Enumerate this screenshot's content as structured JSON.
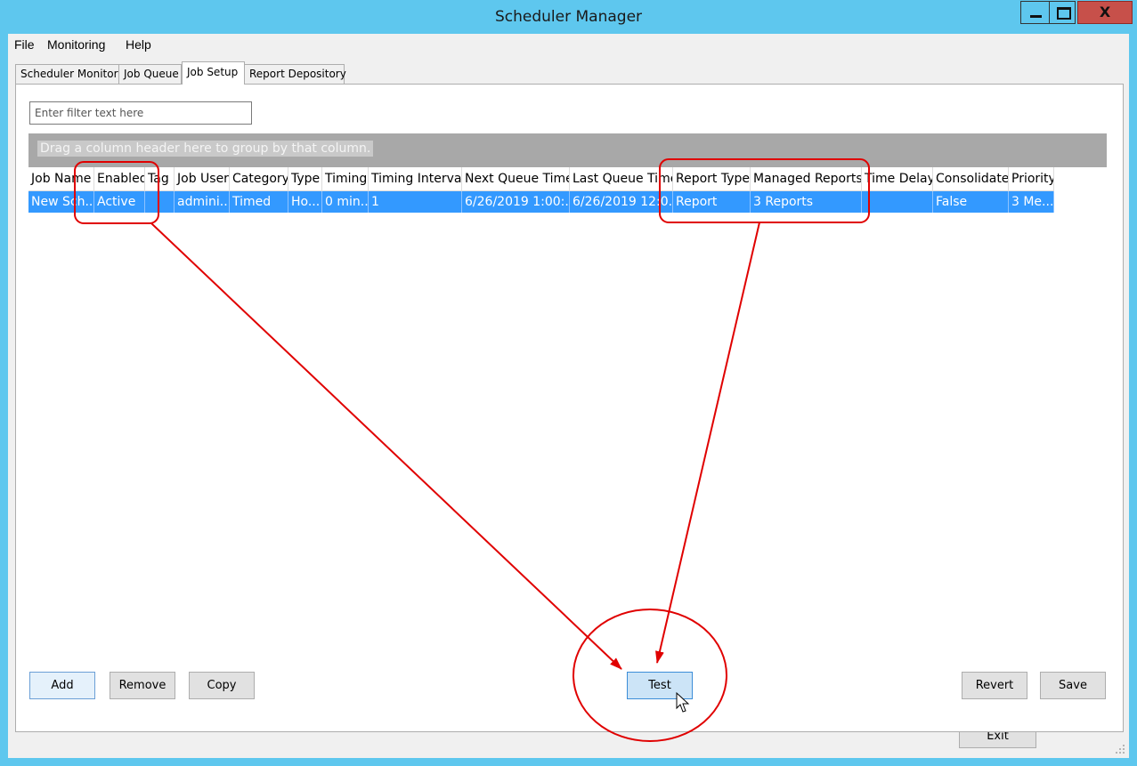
{
  "window": {
    "title": "Scheduler Manager",
    "close_glyph": "X"
  },
  "menu": [
    "File",
    "Monitoring",
    "Help"
  ],
  "tabs": [
    {
      "label": "Scheduler Monitor",
      "active": false
    },
    {
      "label": "Job Queue",
      "active": false
    },
    {
      "label": "Job Setup",
      "active": true
    },
    {
      "label": "Report Depository",
      "active": false
    }
  ],
  "filter": {
    "placeholder": "Enter filter text here",
    "value": ""
  },
  "group_hint": "Drag a column header here to group by that column.",
  "grid": {
    "columns": [
      "Job Name",
      "Enabled",
      "Tag",
      "Job User",
      "Category",
      "Type",
      "Timing",
      "Timing Interval",
      "Next Queue Time",
      "Last Queue Time",
      "Report Type",
      "Managed Reports",
      "Time Delay",
      "Consolidate",
      "Priority"
    ],
    "rows": [
      {
        "selected": true,
        "cells": [
          "New Sch...",
          "Active",
          "",
          "admini...",
          "Timed",
          "Ho...",
          "0 min...",
          "1",
          "6/26/2019 1:00:...",
          "6/26/2019 12:0...",
          "Report",
          "3 Reports",
          "",
          "False",
          "3 Me..."
        ]
      }
    ]
  },
  "buttons": {
    "add": "Add",
    "remove": "Remove",
    "copy": "Copy",
    "test": "Test",
    "revert": "Revert",
    "save": "Save",
    "exit": "Exit"
  },
  "annotation_color": "#e00000",
  "selection_color": "#3399ff",
  "titlebar_color": "#5ec7ee",
  "icons": [
    "minimize-icon",
    "maximize-icon",
    "close-icon",
    "mouse-cursor-icon",
    "resize-grip-icon"
  ]
}
